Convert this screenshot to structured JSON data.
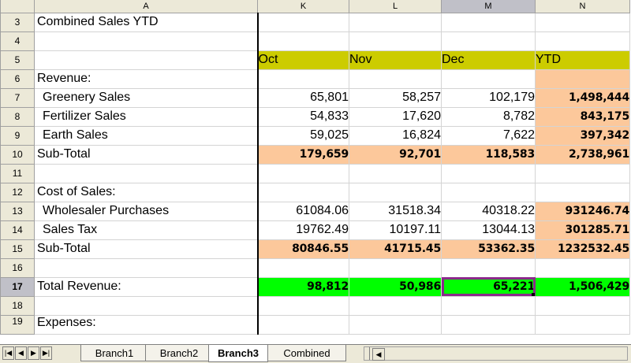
{
  "columns": [
    "A",
    "K",
    "L",
    "M",
    "N"
  ],
  "selected_column": "M",
  "selected_row": "17",
  "rows": [
    {
      "num": "3",
      "a": "Combined Sales YTD",
      "k": "",
      "l": "",
      "m": "",
      "n": ""
    },
    {
      "num": "4",
      "a": "",
      "k": "",
      "l": "",
      "m": "",
      "n": ""
    },
    {
      "num": "5",
      "a": "",
      "k": "Oct",
      "l": "Nov",
      "m": "Dec",
      "n": "YTD"
    },
    {
      "num": "6",
      "a": "Revenue:",
      "k": "",
      "l": "",
      "m": "",
      "n": ""
    },
    {
      "num": "7",
      "a": "Greenery Sales",
      "k": "65,801",
      "l": "58,257",
      "m": "102,179",
      "n": "1,498,444"
    },
    {
      "num": "8",
      "a": "Fertilizer Sales",
      "k": "54,833",
      "l": "17,620",
      "m": "8,782",
      "n": "843,175"
    },
    {
      "num": "9",
      "a": "Earth Sales",
      "k": "59,025",
      "l": "16,824",
      "m": "7,622",
      "n": "397,342"
    },
    {
      "num": "10",
      "a": "Sub-Total",
      "k": "179,659",
      "l": "92,701",
      "m": "118,583",
      "n": "2,738,961"
    },
    {
      "num": "11",
      "a": "",
      "k": "",
      "l": "",
      "m": "",
      "n": ""
    },
    {
      "num": "12",
      "a": "Cost of Sales:",
      "k": "",
      "l": "",
      "m": "",
      "n": ""
    },
    {
      "num": "13",
      "a": "Wholesaler Purchases",
      "k": "61084.06",
      "l": "31518.34",
      "m": "40318.22",
      "n": "931246.74"
    },
    {
      "num": "14",
      "a": "Sales Tax",
      "k": "19762.49",
      "l": "10197.11",
      "m": "13044.13",
      "n": "301285.71"
    },
    {
      "num": "15",
      "a": "Sub-Total",
      "k": "80846.55",
      "l": "41715.45",
      "m": "53362.35",
      "n": "1232532.45"
    },
    {
      "num": "16",
      "a": "",
      "k": "",
      "l": "",
      "m": "",
      "n": ""
    },
    {
      "num": "17",
      "a": "Total Revenue:",
      "k": "98,812",
      "l": "50,986",
      "m": "65,221",
      "n": "1,506,429"
    },
    {
      "num": "18",
      "a": "",
      "k": "",
      "l": "",
      "m": "",
      "n": ""
    },
    {
      "num": "19",
      "a": "Expenses:",
      "k": "",
      "l": "",
      "m": "",
      "n": ""
    }
  ],
  "sheet_tabs": [
    "Branch1",
    "Branch2",
    "Branch3",
    "Combined"
  ],
  "active_tab": "Branch3",
  "nav_icons": [
    "first-sheet-icon",
    "prev-sheet-icon",
    "next-sheet-icon",
    "last-sheet-icon"
  ],
  "colors": {
    "header_yellow": "#cccc00",
    "subtotal_peach": "#fcc89b",
    "total_green": "#00ff00",
    "active_cell_border": "#8a2a8a"
  }
}
